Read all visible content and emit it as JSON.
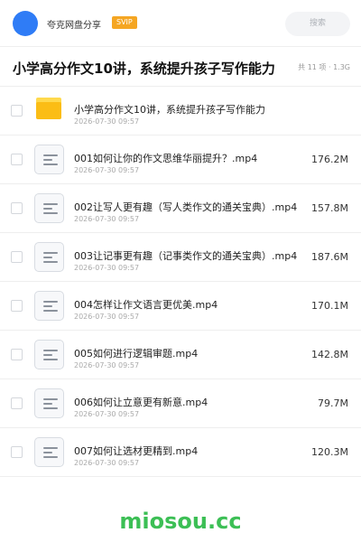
{
  "header": {
    "user_name": "夸克网盘分享",
    "badge": "SVIP",
    "search_placeholder": "搜索",
    "avatar_color": "#2f7cf6"
  },
  "folder": {
    "title": "小学高分作文10讲，系统提升孩子写作能力",
    "meta": "共 11 项 · 1.3G"
  },
  "files": [
    {
      "name": "小学高分作文10讲，系统提升孩子写作能力",
      "date": "2026-07-30 09:57",
      "size": "",
      "icon": "folder-icon"
    },
    {
      "name": "001如何让你的作文思维华丽提升？.mp4",
      "date": "2026-07-30 09:57",
      "size": "176.2M",
      "icon": "document-icon"
    },
    {
      "name": "002让写人更有趣（写人类作文的通关宝典）.mp4",
      "date": "2026-07-30 09:57",
      "size": "157.8M",
      "icon": "document-icon"
    },
    {
      "name": "003让记事更有趣（记事类作文的通关宝典）.mp4",
      "date": "2026-07-30 09:57",
      "size": "187.6M",
      "icon": "document-icon"
    },
    {
      "name": "004怎样让作文语言更优美.mp4",
      "date": "2026-07-30 09:57",
      "size": "170.1M",
      "icon": "document-icon"
    },
    {
      "name": "005如何进行逻辑审题.mp4",
      "date": "2026-07-30 09:57",
      "size": "142.8M",
      "icon": "document-icon"
    },
    {
      "name": "006如何让立意更有新意.mp4",
      "date": "2026-07-30 09:57",
      "size": "79.7M",
      "icon": "document-icon"
    },
    {
      "name": "007如何让选材更精到.mp4",
      "date": "2026-07-30 09:57",
      "size": "120.3M",
      "icon": "document-icon"
    }
  ],
  "watermark": "miosou.cc",
  "colors": {
    "badge": "#f5a623",
    "folder": "#fbbd15",
    "watermark": "#3cbf55"
  }
}
